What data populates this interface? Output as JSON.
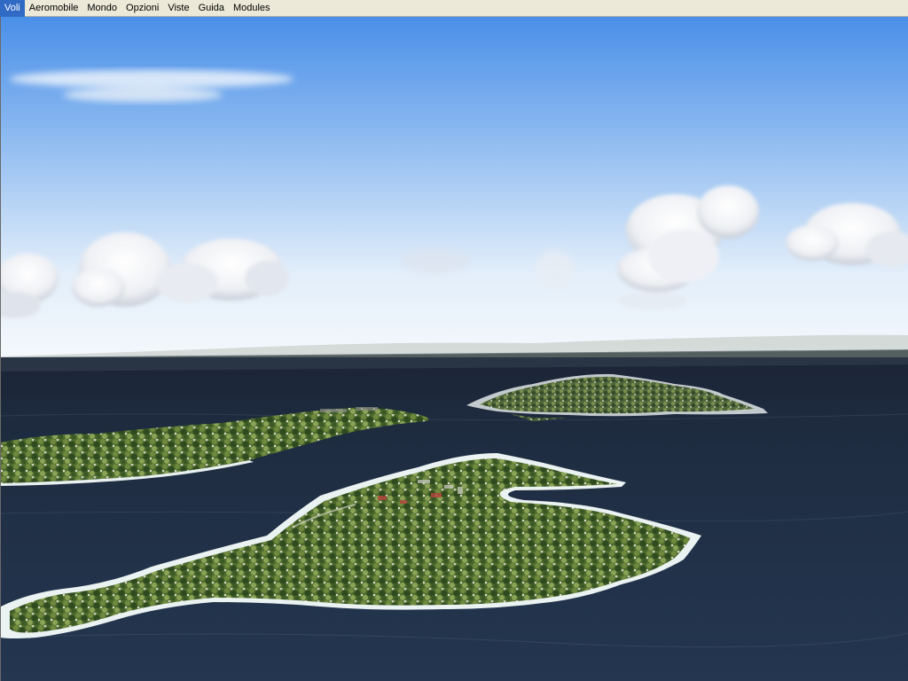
{
  "menubar": {
    "items": [
      {
        "label": "Voli",
        "id": "voli"
      },
      {
        "label": "Aeromobile",
        "id": "aeromobile"
      },
      {
        "label": "Mondo",
        "id": "mondo"
      },
      {
        "label": "Opzioni",
        "id": "opzioni"
      },
      {
        "label": "Viste",
        "id": "viste"
      },
      {
        "label": "Guida",
        "id": "guida"
      },
      {
        "label": "Modules",
        "id": "modules"
      }
    ]
  },
  "scene": {
    "sky_top_color": "#4a8fe8",
    "sky_horizon_color": "#eef5fb",
    "sea_color": "#1e2a3c",
    "land_color": "#4f6a2e"
  }
}
